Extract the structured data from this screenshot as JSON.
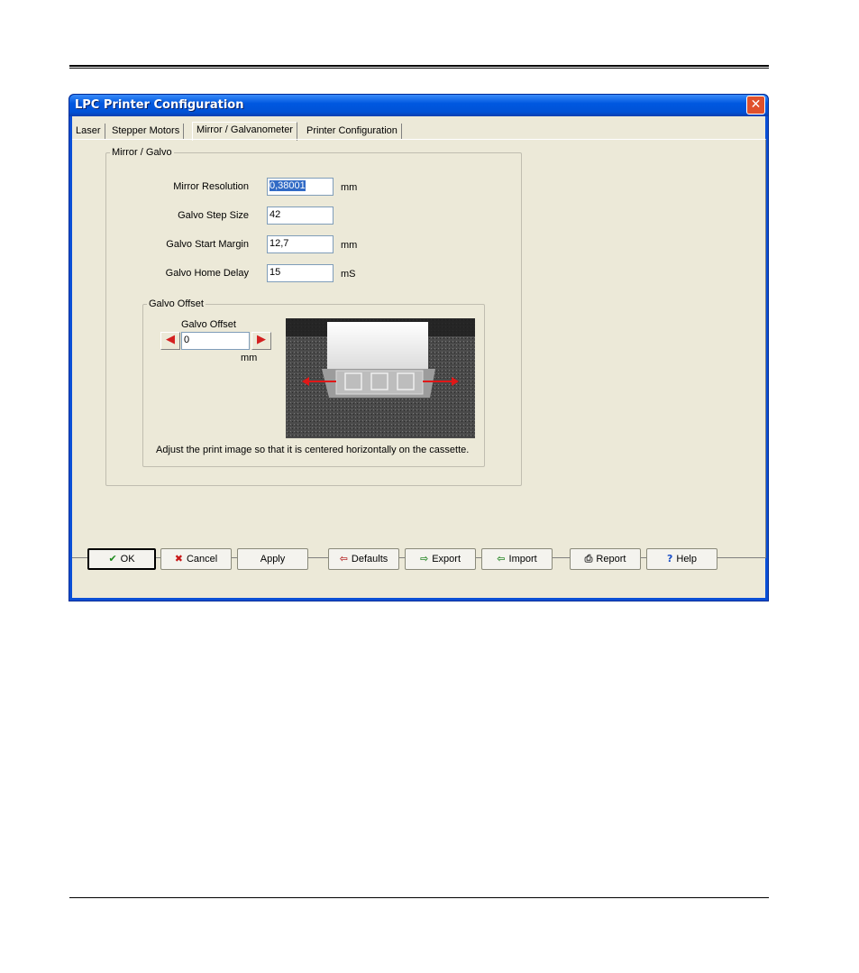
{
  "window": {
    "title": "LPC Printer Configuration",
    "close_glyph": "✕"
  },
  "tabs": [
    {
      "label": "Laser"
    },
    {
      "label": "Stepper Motors"
    },
    {
      "label": "Mirror / Galvanometer",
      "active": true
    },
    {
      "label": "Printer Configuration"
    }
  ],
  "mirror_group": {
    "legend": "Mirror / Galvo",
    "fields": [
      {
        "label": "Mirror Resolution",
        "value": "0,38001",
        "unit": "mm"
      },
      {
        "label": "Galvo Step Size",
        "value": "42",
        "unit": ""
      },
      {
        "label": "Galvo Start Margin",
        "value": "12,7",
        "unit": "mm"
      },
      {
        "label": "Galvo Home Delay",
        "value": "15",
        "unit": "mS"
      }
    ]
  },
  "offset_group": {
    "legend": "Galvo Offset",
    "field_label": "Galvo Offset",
    "value": "0",
    "unit": "mm",
    "left_arrow_icon": "arrow-left-icon",
    "right_arrow_icon": "arrow-right-icon",
    "instruction": "Adjust the print image so that it is centered horizontally on the cassette."
  },
  "buttons": {
    "ok": "OK",
    "cancel": "Cancel",
    "apply": "Apply",
    "defaults": "Defaults",
    "export": "Export",
    "import": "Import",
    "report": "Report",
    "help": "Help"
  },
  "colors": {
    "titlebar": "#0058e0",
    "dialog_bg": "#ece9d8",
    "close": "#e0512c",
    "arrow": "#d42020"
  }
}
